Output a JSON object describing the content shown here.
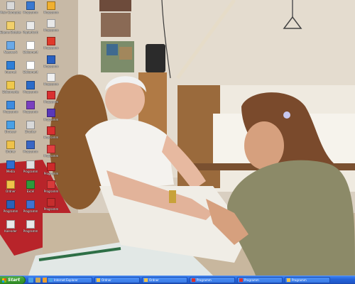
{
  "desktop": {
    "icons": [
      {
        "label": "Mein Computer",
        "color": "#d9d9d9"
      },
      {
        "label": "Eigene Dateien",
        "color": "#f2d06b"
      },
      {
        "label": "Netzwerk",
        "color": "#6aa9e8"
      },
      {
        "label": "Internet",
        "color": "#2f7fd8"
      },
      {
        "label": "Dokumente",
        "color": "#f0c94c"
      },
      {
        "label": "Programm",
        "color": "#3d8be0"
      },
      {
        "label": "Browser",
        "color": "#4aa0e6"
      },
      {
        "label": "Ordner",
        "color": "#efc24a"
      },
      {
        "label": "Media",
        "color": "#2f6fd0"
      },
      {
        "label": "Ordner",
        "color": "#efc24a"
      },
      {
        "label": "Programm",
        "color": "#2a62b8"
      },
      {
        "label": "Kalender",
        "color": "#e9e9e9"
      },
      {
        "label": "Programm",
        "color": "#3a78d0"
      },
      {
        "label": "Papierkorb",
        "color": "#eaeaea"
      },
      {
        "label": "Dokument",
        "color": "#ffffff"
      },
      {
        "label": "Dokument",
        "color": "#ffffff"
      },
      {
        "label": "Programm",
        "color": "#2b6bc9"
      },
      {
        "label": "Programm",
        "color": "#7a3fbf"
      },
      {
        "label": "Drucker",
        "color": "#d8d8d8"
      },
      {
        "label": "Programm",
        "color": "#3a66c4"
      },
      {
        "label": "Programm",
        "color": "#e0e0e0"
      },
      {
        "label": "Excel",
        "color": "#2e9a3c"
      },
      {
        "label": "Programm",
        "color": "#3f73d2"
      },
      {
        "label": "Programm",
        "color": "#e8e8e8"
      },
      {
        "label": "Programm",
        "color": "#f0b030"
      },
      {
        "label": "Programm",
        "color": "#e8e8e8"
      },
      {
        "label": "Programm",
        "color": "#e03a2a"
      },
      {
        "label": "Programm",
        "color": "#2a60c0"
      },
      {
        "label": "Programm",
        "color": "#f0f0f0"
      },
      {
        "label": "Programm",
        "color": "#d93030"
      },
      {
        "label": "Programm",
        "color": "#5a38b8"
      },
      {
        "label": "Programm",
        "color": "#d93030"
      },
      {
        "label": "Programm",
        "color": "#e04040"
      },
      {
        "label": "Programm",
        "color": "#cc2a2a"
      },
      {
        "label": "Programm",
        "color": "#d83a3a"
      },
      {
        "label": "Programm",
        "color": "#c62d2d"
      }
    ]
  },
  "taskbar": {
    "start_label": "Start",
    "quick_launch": [
      {
        "name": "browser",
        "color": "#4aa0e6"
      },
      {
        "name": "show-desktop",
        "color": "#c9a85a"
      },
      {
        "name": "media",
        "color": "#f0a030"
      }
    ],
    "tasks": [
      {
        "label": "Internet Explorer",
        "icon_color": "#4aa0e6"
      },
      {
        "label": "Ordner",
        "icon_color": "#efc24a"
      },
      {
        "label": "Ordner",
        "icon_color": "#efc24a"
      },
      {
        "label": "Programm",
        "icon_color": "#d93030"
      },
      {
        "label": "Programm",
        "icon_color": "#d93030"
      },
      {
        "label": "Programm",
        "icon_color": "#efc24a"
      }
    ]
  }
}
